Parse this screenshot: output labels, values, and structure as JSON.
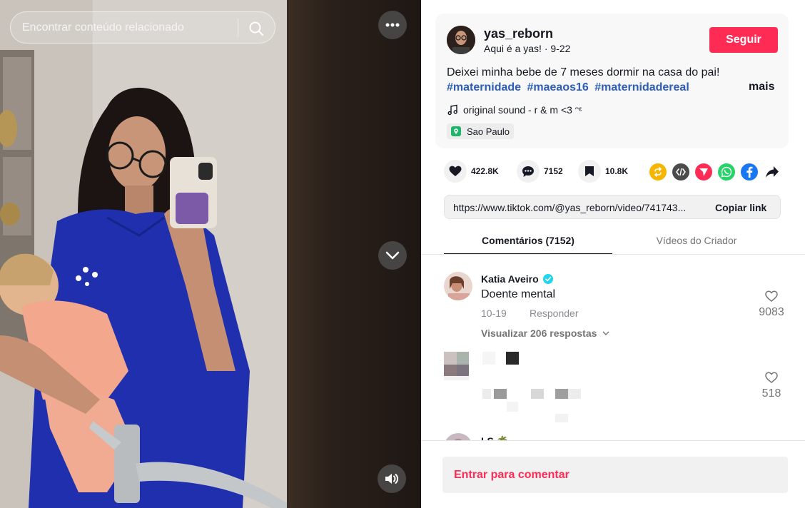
{
  "search": {
    "placeholder": "Encontrar conteúdo relacionado"
  },
  "author": {
    "username": "yas_reborn",
    "nickname": "Aqui é a yas!",
    "date": "9-22",
    "follow_label": "Seguir"
  },
  "post": {
    "description": "Deixei minha bebe de 7 meses dormir na casa do pai!",
    "hashtags": [
      "#maternidade",
      "#maeaos16",
      "#maternidadereal"
    ],
    "more_label": "mais",
    "sound": "original sound - r & m <3 ᵔᵋ",
    "location": "Sao Paulo"
  },
  "actions": {
    "likes": "422.8K",
    "comments": "7152",
    "saves": "10.8K",
    "share_icons": [
      "repost-icon",
      "embed-icon",
      "send-icon",
      "whatsapp-icon",
      "facebook-icon",
      "share-arrow-icon"
    ]
  },
  "link": {
    "url": "https://www.tiktok.com/@yas_reborn/video/741743...",
    "copy_label": "Copiar link"
  },
  "tabs": [
    {
      "label": "Comentários (7152)",
      "active": true
    },
    {
      "label": "Vídeos do Criador",
      "active": false
    }
  ],
  "comments": [
    {
      "name": "Katia Aveiro",
      "verified": true,
      "text": "Doente mental",
      "date": "10-19",
      "reply_label": "Responder",
      "view_replies": "Visualizar 206 respostas",
      "likes": "9083"
    },
    {
      "name": "",
      "text": "",
      "likes": "518"
    },
    {
      "name": "LS 🌴",
      "text": ""
    }
  ],
  "footer": {
    "comment_prompt": "Entrar para comentar"
  },
  "colors": {
    "accent": "#fe2c55",
    "hashtag": "#2b5db9",
    "verified": "#20d5ec"
  }
}
